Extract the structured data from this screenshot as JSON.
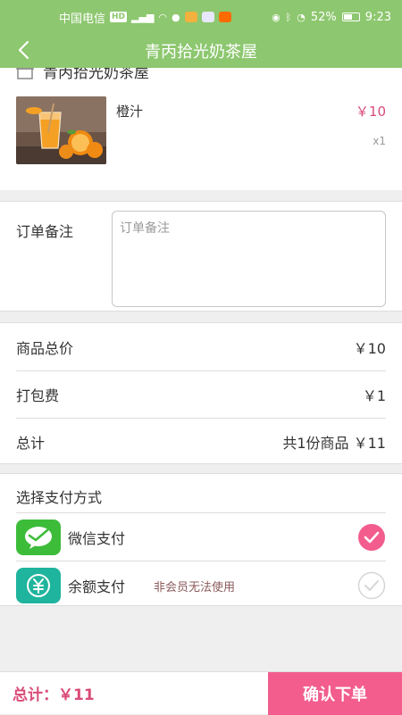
{
  "status_bar": {
    "carrier": "中国电信",
    "battery": "52%",
    "time": "9:23"
  },
  "nav": {
    "title": "青丙拾光奶茶屋"
  },
  "shop": {
    "name": "青丙拾光奶茶屋"
  },
  "item": {
    "name": "橙汁",
    "price": "￥10",
    "quantity": "x1"
  },
  "remark": {
    "label": "订单备注",
    "placeholder": "订单备注"
  },
  "summary": {
    "goods_label": "商品总价",
    "goods_value": "￥10",
    "packing_label": "打包费",
    "packing_value": "￥1",
    "total_label": "总计",
    "total_value": "共1份商品 ￥11"
  },
  "payment": {
    "heading": "选择支付方式",
    "options": [
      {
        "label": "微信支付",
        "note": "",
        "selected": true,
        "icon": "wechat-icon"
      },
      {
        "label": "余额支付",
        "note": "非会员无法使用",
        "selected": false,
        "icon": "yuan-icon"
      }
    ]
  },
  "bottom": {
    "total": "总计：￥11",
    "confirm_label": "确认下单"
  },
  "colors": {
    "primary_green": "#8dc76f",
    "accent_pink": "#f25d8e",
    "price_pink": "#d94c78"
  }
}
